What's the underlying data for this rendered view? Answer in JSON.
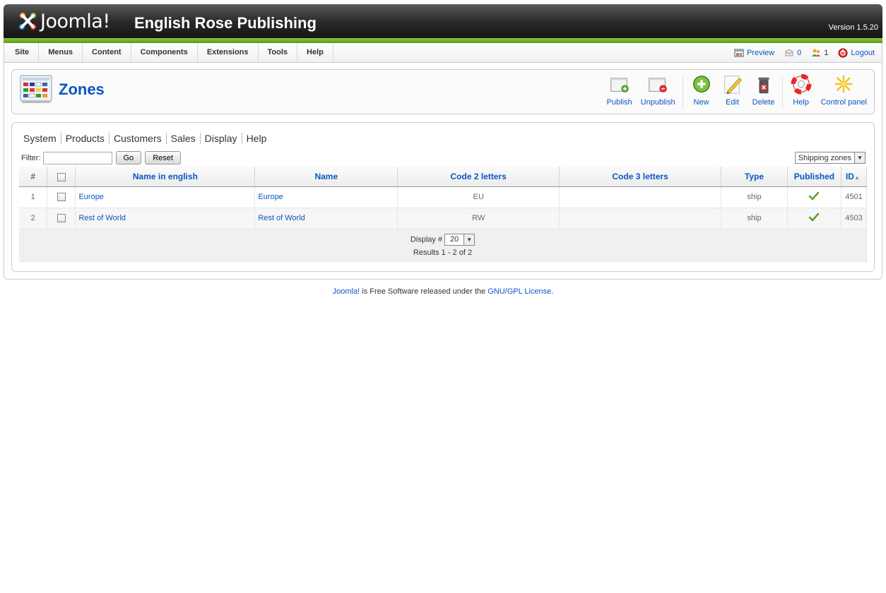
{
  "header": {
    "logo_text": "Joomla!",
    "site_title": "English Rose Publishing",
    "version": "Version 1.5.20"
  },
  "menu": {
    "items": [
      "Site",
      "Menus",
      "Content",
      "Components",
      "Extensions",
      "Tools",
      "Help"
    ]
  },
  "status": {
    "preview": "Preview",
    "messages_count": "0",
    "users_count": "1",
    "logout": "Logout"
  },
  "page": {
    "title": "Zones"
  },
  "toolbar": {
    "publish": "Publish",
    "unpublish": "Unpublish",
    "new": "New",
    "edit": "Edit",
    "delete": "Delete",
    "help": "Help",
    "control_panel": "Control panel"
  },
  "submenu": [
    "System",
    "Products",
    "Customers",
    "Sales",
    "Display",
    "Help"
  ],
  "filter": {
    "label": "Filter:",
    "value": "",
    "go": "Go",
    "reset": "Reset",
    "zone_type_selected": "Shipping zones"
  },
  "table": {
    "headers": {
      "num": "#",
      "name_english": "Name in english",
      "name": "Name",
      "code2": "Code 2 letters",
      "code3": "Code 3 letters",
      "type": "Type",
      "published": "Published",
      "id": "ID"
    },
    "rows": [
      {
        "num": "1",
        "name_english": "Europe",
        "name": "Europe",
        "code2": "EU",
        "code3": "",
        "type": "ship",
        "published": true,
        "id": "4501"
      },
      {
        "num": "2",
        "name_english": "Rest of World",
        "name": "Rest of World",
        "code2": "RW",
        "code3": "",
        "type": "ship",
        "published": true,
        "id": "4503"
      }
    ],
    "footer": {
      "display_label": "Display #",
      "display_value": "20",
      "results": "Results 1 - 2 of 2"
    }
  },
  "footer": {
    "joomla_link": "Joomla!",
    "middle_text": " is Free Software released under the ",
    "license_link": "GNU/GPL License",
    "end": "."
  },
  "colors": {
    "link": "#0b55c4",
    "header_dark": "#1a1a1a",
    "header_green": "#6aae23",
    "check_green": "#5aa02c"
  }
}
